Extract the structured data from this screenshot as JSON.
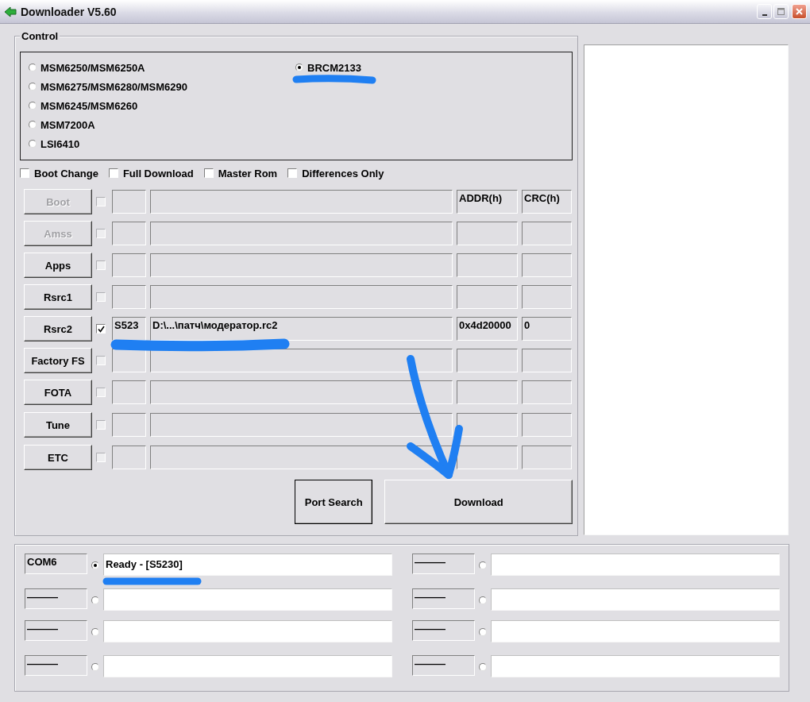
{
  "window": {
    "title": "Downloader V5.60"
  },
  "control": {
    "title": "Control",
    "chipsets": [
      {
        "label": "MSM6250/MSM6250A",
        "selected": false
      },
      {
        "label": "MSM6275/MSM6280/MSM6290",
        "selected": false
      },
      {
        "label": "MSM6245/MSM6260",
        "selected": false
      },
      {
        "label": "MSM7200A",
        "selected": false
      },
      {
        "label": "LSI6410",
        "selected": false
      },
      {
        "label": "BRCM2133",
        "selected": true
      }
    ],
    "options": [
      {
        "label": "Boot Change",
        "checked": false
      },
      {
        "label": "Full Download",
        "checked": false
      },
      {
        "label": "Master Rom",
        "checked": false
      },
      {
        "label": "Differences Only",
        "checked": false
      }
    ],
    "files": [
      {
        "button": "Boot",
        "disabled": true,
        "checked": false,
        "addr": "ADDR(h)",
        "crc": "CRC(h)"
      },
      {
        "button": "Amss",
        "disabled": true,
        "checked": false
      },
      {
        "button": "Apps",
        "disabled": false,
        "checked": false
      },
      {
        "button": "Rsrc1",
        "disabled": false,
        "checked": false
      },
      {
        "button": "Rsrc2",
        "disabled": false,
        "checked": true,
        "model": "S523",
        "path": "D:\\...\\патч\\модератор.rc2",
        "addr": "0x4d20000",
        "crc": "0"
      },
      {
        "button": "Factory FS",
        "disabled": false,
        "checked": false
      },
      {
        "button": "FOTA",
        "disabled": false,
        "checked": false
      },
      {
        "button": "Tune",
        "disabled": false,
        "checked": false
      },
      {
        "button": "ETC",
        "disabled": false,
        "checked": false
      }
    ],
    "actions": [
      "Port Search",
      "Download"
    ]
  },
  "ports": [
    {
      "port": "COM6",
      "selected": true,
      "status": "Ready - [S5230]"
    },
    {
      "port": "———",
      "selected": false
    },
    {
      "port": "———",
      "selected": false
    },
    {
      "port": "———",
      "selected": false
    },
    {
      "port": "———",
      "selected": false
    },
    {
      "port": "———",
      "selected": false
    },
    {
      "port": "———",
      "selected": false
    },
    {
      "port": "———",
      "selected": false
    }
  ]
}
